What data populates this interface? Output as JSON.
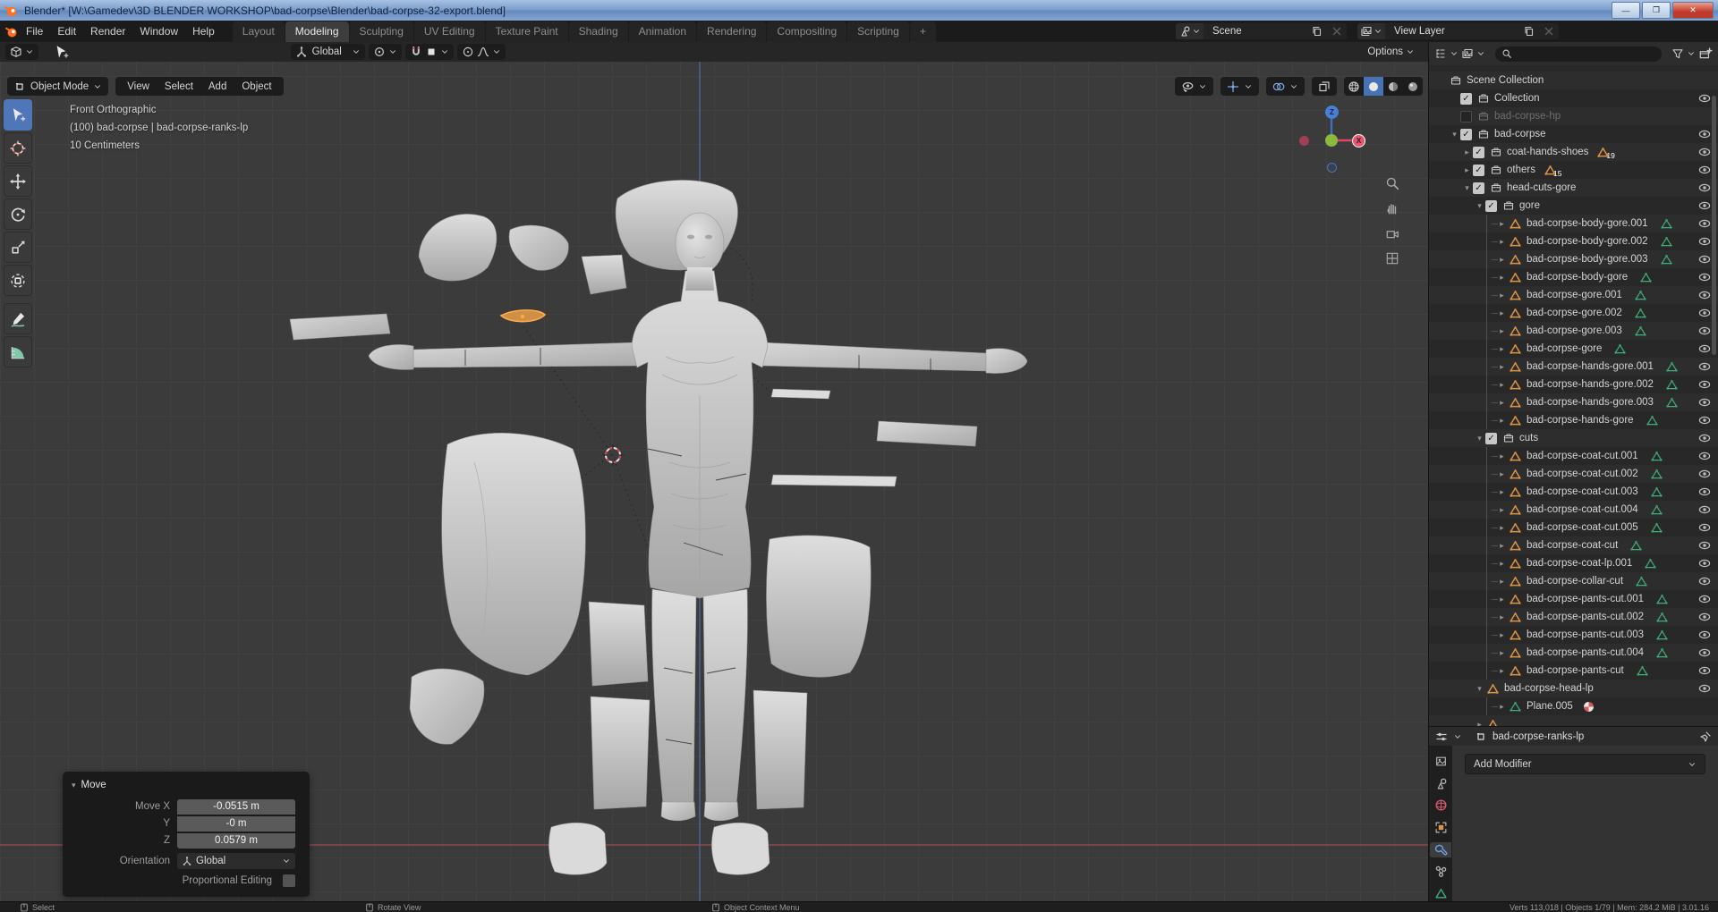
{
  "window": {
    "title": "Blender* [W:\\Gamedev\\3D BLENDER WORKSHOP\\bad-corpse\\Blender\\bad-corpse-32-export.blend]",
    "buttons": {
      "minimize": "—",
      "maximize": "❐",
      "close": "✕"
    }
  },
  "menubar": {
    "menus": [
      "File",
      "Edit",
      "Render",
      "Window",
      "Help"
    ],
    "tabs": [
      {
        "label": "Layout",
        "active": false
      },
      {
        "label": "Modeling",
        "active": true
      },
      {
        "label": "Sculpting",
        "active": false
      },
      {
        "label": "UV Editing",
        "active": false
      },
      {
        "label": "Texture Paint",
        "active": false
      },
      {
        "label": "Shading",
        "active": false
      },
      {
        "label": "Animation",
        "active": false
      },
      {
        "label": "Rendering",
        "active": false
      },
      {
        "label": "Compositing",
        "active": false
      },
      {
        "label": "Scripting",
        "active": false
      }
    ],
    "new_workspace_label": "+",
    "scene": {
      "label": "Scene"
    },
    "view_layer": {
      "label": "View Layer"
    }
  },
  "viewport_header": {
    "orientation": "Global",
    "options_label": "Options",
    "mode": "Object Mode",
    "menus": [
      "View",
      "Select",
      "Add",
      "Object"
    ]
  },
  "toolbar": {
    "tools": [
      "select-box",
      "cursor",
      "move",
      "rotate",
      "scale",
      "transform",
      "annotate",
      "measure"
    ],
    "active": "select-box"
  },
  "viewport": {
    "overlay_lines": [
      "Front Orthographic",
      "(100) bad-corpse | bad-corpse-ranks-lp",
      "10 Centimeters"
    ]
  },
  "outliner": {
    "items": [
      {
        "label": "Scene Collection",
        "depth": 0,
        "icon": "collection",
        "expand": "none",
        "checkbox": null,
        "eye": false
      },
      {
        "label": "Collection",
        "depth": 1,
        "icon": "collection",
        "expand": "none",
        "checkbox": true,
        "eye": true
      },
      {
        "label": "bad-corpse-hp",
        "depth": 1,
        "icon": "collection",
        "expand": "none",
        "checkbox": false,
        "eye": false,
        "dimmed": true
      },
      {
        "label": "bad-corpse",
        "depth": 1,
        "icon": "collection",
        "expand": "open",
        "checkbox": true,
        "eye": true
      },
      {
        "label": "coat-hands-shoes",
        "depth": 2,
        "icon": "collection",
        "expand": "closed",
        "checkbox": true,
        "eye": true,
        "count": 19
      },
      {
        "label": "others",
        "depth": 2,
        "icon": "collection",
        "expand": "closed",
        "checkbox": true,
        "eye": true,
        "count": 15
      },
      {
        "label": "head-cuts-gore",
        "depth": 2,
        "icon": "collection",
        "expand": "open",
        "checkbox": true,
        "eye": true
      },
      {
        "label": "gore",
        "depth": 3,
        "icon": "collection",
        "expand": "open",
        "checkbox": true,
        "eye": true
      },
      {
        "label": "bad-corpse-body-gore.001",
        "depth": 4,
        "icon": "mesh-object",
        "expand": "closed",
        "eye": true,
        "data": true
      },
      {
        "label": "bad-corpse-body-gore.002",
        "depth": 4,
        "icon": "mesh-object",
        "expand": "closed",
        "eye": true,
        "data": true
      },
      {
        "label": "bad-corpse-body-gore.003",
        "depth": 4,
        "icon": "mesh-object",
        "expand": "closed",
        "eye": true,
        "data": true
      },
      {
        "label": "bad-corpse-body-gore",
        "depth": 4,
        "icon": "mesh-object",
        "expand": "closed",
        "eye": true,
        "data": true
      },
      {
        "label": "bad-corpse-gore.001",
        "depth": 4,
        "icon": "mesh-object",
        "expand": "closed",
        "eye": true,
        "data": true
      },
      {
        "label": "bad-corpse-gore.002",
        "depth": 4,
        "icon": "mesh-object",
        "expand": "closed",
        "eye": true,
        "data": true
      },
      {
        "label": "bad-corpse-gore.003",
        "depth": 4,
        "icon": "mesh-object",
        "expand": "closed",
        "eye": true,
        "data": true
      },
      {
        "label": "bad-corpse-gore",
        "depth": 4,
        "icon": "mesh-object",
        "expand": "closed",
        "eye": true,
        "data": true
      },
      {
        "label": "bad-corpse-hands-gore.001",
        "depth": 4,
        "icon": "mesh-object",
        "expand": "closed",
        "eye": true,
        "data": true
      },
      {
        "label": "bad-corpse-hands-gore.002",
        "depth": 4,
        "icon": "mesh-object",
        "expand": "closed",
        "eye": true,
        "data": true
      },
      {
        "label": "bad-corpse-hands-gore.003",
        "depth": 4,
        "icon": "mesh-object",
        "expand": "closed",
        "eye": true,
        "data": true
      },
      {
        "label": "bad-corpse-hands-gore",
        "depth": 4,
        "icon": "mesh-object",
        "expand": "closed",
        "eye": true,
        "data": true
      },
      {
        "label": "cuts",
        "depth": 3,
        "icon": "collection",
        "expand": "open",
        "checkbox": true,
        "eye": true
      },
      {
        "label": "bad-corpse-coat-cut.001",
        "depth": 4,
        "icon": "mesh-object",
        "expand": "closed",
        "eye": true,
        "data": true
      },
      {
        "label": "bad-corpse-coat-cut.002",
        "depth": 4,
        "icon": "mesh-object",
        "expand": "closed",
        "eye": true,
        "data": true
      },
      {
        "label": "bad-corpse-coat-cut.003",
        "depth": 4,
        "icon": "mesh-object",
        "expand": "closed",
        "eye": true,
        "data": true
      },
      {
        "label": "bad-corpse-coat-cut.004",
        "depth": 4,
        "icon": "mesh-object",
        "expand": "closed",
        "eye": true,
        "data": true
      },
      {
        "label": "bad-corpse-coat-cut.005",
        "depth": 4,
        "icon": "mesh-object",
        "expand": "closed",
        "eye": true,
        "data": true
      },
      {
        "label": "bad-corpse-coat-cut",
        "depth": 4,
        "icon": "mesh-object",
        "expand": "closed",
        "eye": true,
        "data": true
      },
      {
        "label": "bad-corpse-coat-lp.001",
        "depth": 4,
        "icon": "mesh-object",
        "expand": "closed",
        "eye": true,
        "data": true
      },
      {
        "label": "bad-corpse-collar-cut",
        "depth": 4,
        "icon": "mesh-object",
        "expand": "closed",
        "eye": true,
        "data": true
      },
      {
        "label": "bad-corpse-pants-cut.001",
        "depth": 4,
        "icon": "mesh-object",
        "expand": "closed",
        "eye": true,
        "data": true
      },
      {
        "label": "bad-corpse-pants-cut.002",
        "depth": 4,
        "icon": "mesh-object",
        "expand": "closed",
        "eye": true,
        "data": true
      },
      {
        "label": "bad-corpse-pants-cut.003",
        "depth": 4,
        "icon": "mesh-object",
        "expand": "closed",
        "eye": true,
        "data": true
      },
      {
        "label": "bad-corpse-pants-cut.004",
        "depth": 4,
        "icon": "mesh-object",
        "expand": "closed",
        "eye": true,
        "data": true
      },
      {
        "label": "bad-corpse-pants-cut",
        "depth": 4,
        "icon": "mesh-object",
        "expand": "closed",
        "eye": true,
        "data": true
      },
      {
        "label": "bad-corpse-head-lp",
        "depth": 3,
        "icon": "mesh-object",
        "expand": "open",
        "eye": true
      },
      {
        "label": "Plane.005",
        "depth": 4,
        "icon": "mesh-data",
        "expand": "closed",
        "material": true
      },
      {
        "label": "",
        "depth": 3,
        "icon": "mesh-object",
        "expand": "closed",
        "partial": true
      }
    ]
  },
  "properties": {
    "breadcrumb": "bad-corpse-ranks-lp",
    "add_modifier_label": "Add Modifier",
    "tabs": [
      "render",
      "scene",
      "world",
      "object",
      "modifiers",
      "physics",
      "data"
    ],
    "active_tab": "modifiers"
  },
  "move_panel": {
    "title": "Move",
    "fields": [
      {
        "label": "Move X",
        "value": "-0.0515 m"
      },
      {
        "label": "Y",
        "value": "-0 m"
      },
      {
        "label": "Z",
        "value": "0.0579 m"
      }
    ],
    "orientation_label": "Orientation",
    "orientation_value": "Global",
    "prop_edit_label": "Proportional Editing"
  },
  "status_bar": {
    "left": [
      {
        "label": "Select"
      },
      {
        "label": "Rotate View"
      },
      {
        "label": "Object Context Menu"
      }
    ],
    "right": "Verts 113,018 | Objects 1/79 | Mem: 284.2 MiB | 3.01.16"
  },
  "colors": {
    "accent": "#4772b3",
    "object_orange": "#dd9346",
    "data_green": "#3fae78",
    "axis_x": "#e0485f",
    "axis_y": "#6ba32f",
    "axis_z": "#3d6fc9",
    "selection_orange": "#ffaa4d"
  }
}
